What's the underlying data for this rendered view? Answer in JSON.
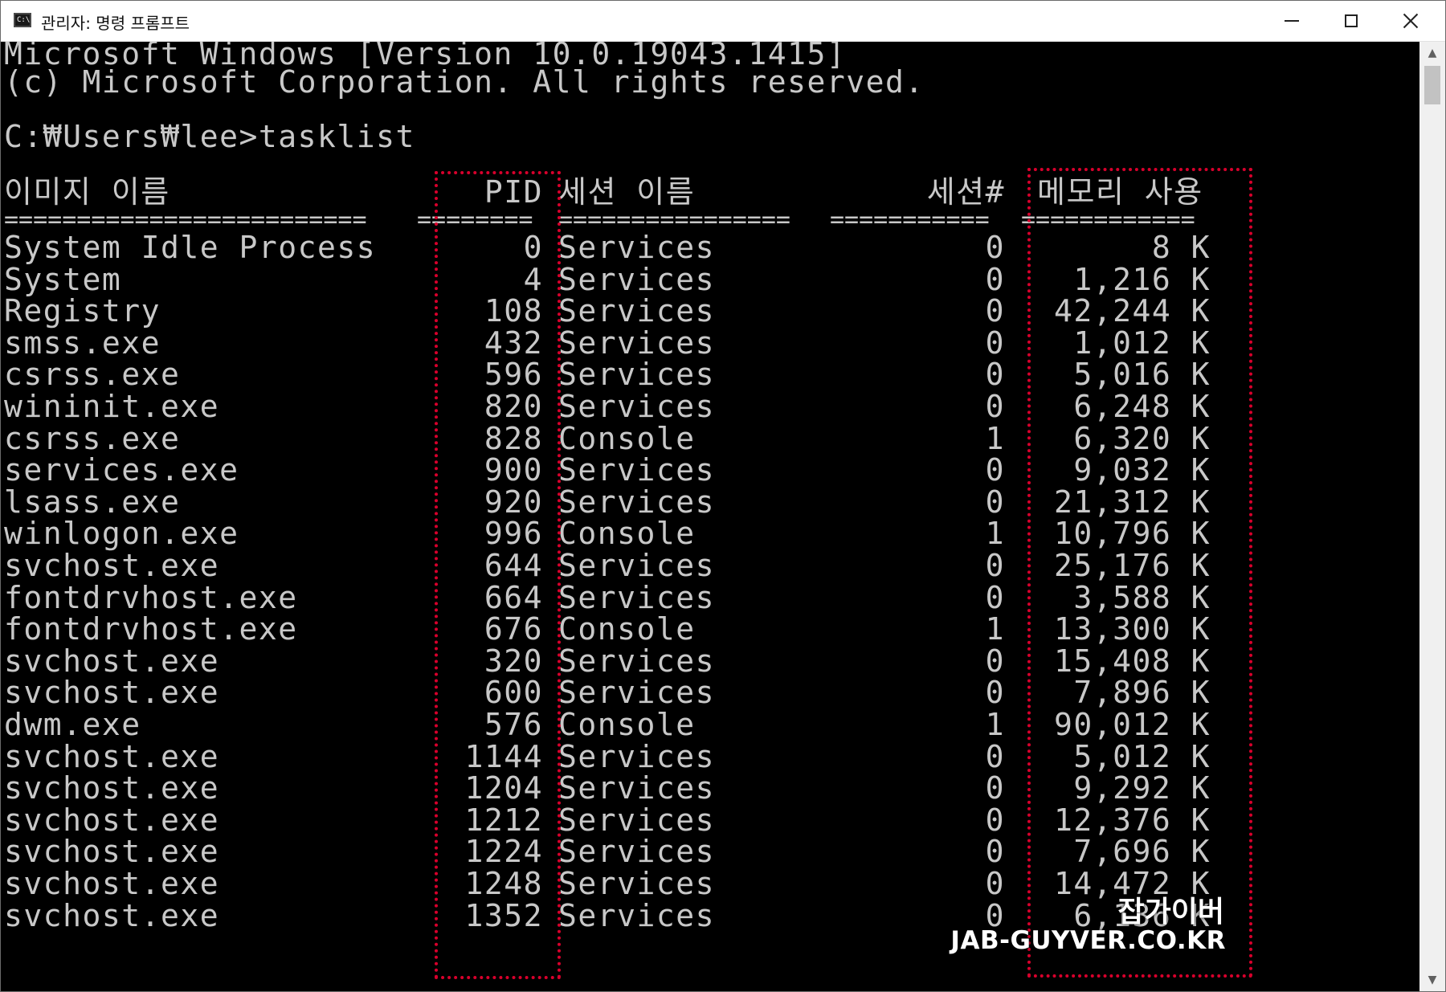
{
  "window": {
    "title": "관리자: 명령 프롬프트",
    "icon": "cmd-icon",
    "buttons": {
      "minimize": "minimize-icon",
      "maximize": "maximize-icon",
      "close": "close-icon"
    }
  },
  "console": {
    "banner_line1": "Microsoft Windows [Version 10.0.19043.1415]",
    "banner_line2": "(c) Microsoft Corporation. All rights reserved.",
    "prompt": "C:₩Users₩lee>tasklist",
    "headers": {
      "image": "이미지 이름",
      "pid": "PID",
      "session": "세션 이름",
      "session_num": "세션#",
      "memory": "메모리 사용"
    },
    "separators": {
      "image": "=========================",
      "pid": "========",
      "session": "================",
      "session_num": "===========",
      "memory": "============"
    },
    "rows": [
      {
        "image": "System Idle Process",
        "pid": "0",
        "session": "Services",
        "num": "0",
        "mem": "8 K"
      },
      {
        "image": "System",
        "pid": "4",
        "session": "Services",
        "num": "0",
        "mem": "1,216 K"
      },
      {
        "image": "Registry",
        "pid": "108",
        "session": "Services",
        "num": "0",
        "mem": "42,244 K"
      },
      {
        "image": "smss.exe",
        "pid": "432",
        "session": "Services",
        "num": "0",
        "mem": "1,012 K"
      },
      {
        "image": "csrss.exe",
        "pid": "596",
        "session": "Services",
        "num": "0",
        "mem": "5,016 K"
      },
      {
        "image": "wininit.exe",
        "pid": "820",
        "session": "Services",
        "num": "0",
        "mem": "6,248 K"
      },
      {
        "image": "csrss.exe",
        "pid": "828",
        "session": "Console",
        "num": "1",
        "mem": "6,320 K"
      },
      {
        "image": "services.exe",
        "pid": "900",
        "session": "Services",
        "num": "0",
        "mem": "9,032 K"
      },
      {
        "image": "lsass.exe",
        "pid": "920",
        "session": "Services",
        "num": "0",
        "mem": "21,312 K"
      },
      {
        "image": "winlogon.exe",
        "pid": "996",
        "session": "Console",
        "num": "1",
        "mem": "10,796 K"
      },
      {
        "image": "svchost.exe",
        "pid": "644",
        "session": "Services",
        "num": "0",
        "mem": "25,176 K"
      },
      {
        "image": "fontdrvhost.exe",
        "pid": "664",
        "session": "Services",
        "num": "0",
        "mem": "3,588 K"
      },
      {
        "image": "fontdrvhost.exe",
        "pid": "676",
        "session": "Console",
        "num": "1",
        "mem": "13,300 K"
      },
      {
        "image": "svchost.exe",
        "pid": "320",
        "session": "Services",
        "num": "0",
        "mem": "15,408 K"
      },
      {
        "image": "svchost.exe",
        "pid": "600",
        "session": "Services",
        "num": "0",
        "mem": "7,896 K"
      },
      {
        "image": "dwm.exe",
        "pid": "576",
        "session": "Console",
        "num": "1",
        "mem": "90,012 K"
      },
      {
        "image": "svchost.exe",
        "pid": "1144",
        "session": "Services",
        "num": "0",
        "mem": "5,012 K"
      },
      {
        "image": "svchost.exe",
        "pid": "1204",
        "session": "Services",
        "num": "0",
        "mem": "9,292 K"
      },
      {
        "image": "svchost.exe",
        "pid": "1212",
        "session": "Services",
        "num": "0",
        "mem": "12,376 K"
      },
      {
        "image": "svchost.exe",
        "pid": "1224",
        "session": "Services",
        "num": "0",
        "mem": "7,696 K"
      },
      {
        "image": "svchost.exe",
        "pid": "1248",
        "session": "Services",
        "num": "0",
        "mem": "14,472 K"
      },
      {
        "image": "svchost.exe",
        "pid": "1352",
        "session": "Services",
        "num": "0",
        "mem": "6,136 K"
      }
    ]
  },
  "highlight_color": "#d8002c",
  "watermark": {
    "korean": "잡가이버",
    "english": "JAB-GUYVER.CO.KR"
  }
}
